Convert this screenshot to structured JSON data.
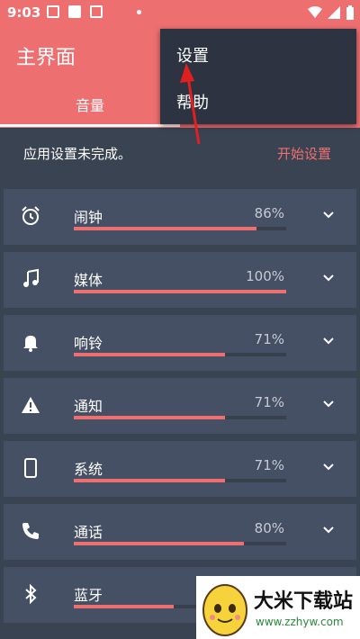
{
  "status": {
    "time": "9:03"
  },
  "app": {
    "title": "主界面",
    "tab": "音量"
  },
  "menu": {
    "items": [
      "设置",
      "帮助"
    ]
  },
  "notice": {
    "text": "应用设置未完成。",
    "action": "开始设置"
  },
  "rows": [
    {
      "label": "闹钟",
      "percent": "86%",
      "fill": 0.86,
      "icon": "alarm-clock-icon"
    },
    {
      "label": "媒体",
      "percent": "100%",
      "fill": 1.0,
      "icon": "music-note-icon"
    },
    {
      "label": "响铃",
      "percent": "71%",
      "fill": 0.71,
      "icon": "bell-icon"
    },
    {
      "label": "通知",
      "percent": "71%",
      "fill": 0.71,
      "icon": "warning-icon"
    },
    {
      "label": "系统",
      "percent": "71%",
      "fill": 0.71,
      "icon": "phone-device-icon"
    },
    {
      "label": "通话",
      "percent": "80%",
      "fill": 0.8,
      "icon": "phone-call-icon"
    },
    {
      "label": "蓝牙",
      "percent": "",
      "fill": 0.47,
      "icon": "bluetooth-icon"
    }
  ],
  "watermark": {
    "text": "大米下载站",
    "url": "www.zzhyw.com"
  },
  "colors": {
    "accent": "#ee6f70",
    "background": "#3a4352",
    "row": "#465064",
    "menu": "#2d3340"
  }
}
